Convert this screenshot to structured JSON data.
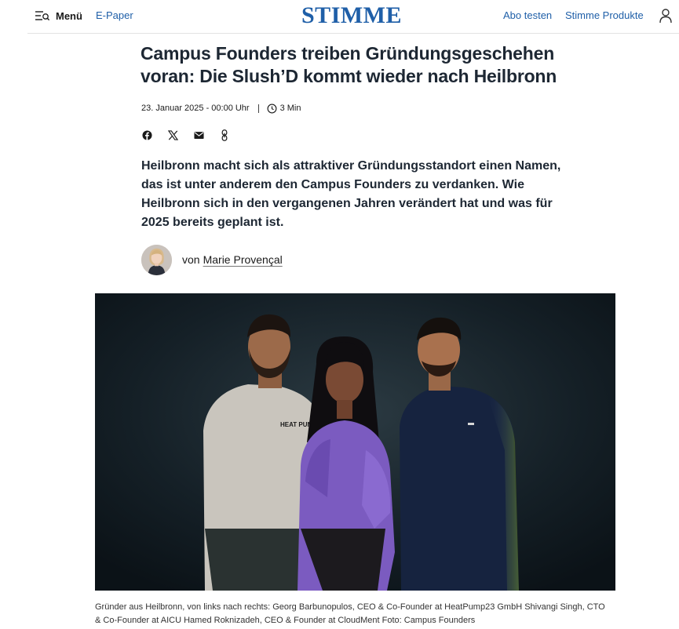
{
  "header": {
    "menu_label": "Menü",
    "epaper_label": "E-Paper",
    "logo_text": "STIMME",
    "abo_label": "Abo testen",
    "produkte_label": "Stimme Produkte",
    "brand_color": "#1f5fa8"
  },
  "article": {
    "headline": "Campus Founders treiben Gründungsgeschehen voran: Die Slush’D kommt wieder nach Heilbronn",
    "date": "23. Januar 2025 - 00:00 Uhr",
    "read_time": "3 Min",
    "share": [
      "facebook-icon",
      "x-icon",
      "mail-icon",
      "link-icon"
    ],
    "lead": "Heilbronn macht sich als attraktiver Gründungsstandort einen Namen, das ist unter anderem den Campus Founders zu verdanken. Wie Heilbronn sich in den vergangenen Jahren verändert hat und was für 2025 bereits geplant ist.",
    "author_prefix": "von",
    "author_name": "Marie Provençal",
    "photo_caption": "Gründer aus Heilbronn, von links nach rechts: Georg Barbunopulos, CEO & Co-Founder at HeatPump23 GmbH Shivangi Singh, CTO & Co-Founder at AICU Hamed Roknizadeh, CEO & Founder at CloudMent  Foto: Campus Founders",
    "sweater_logo_text": "HEAT PUMP23"
  }
}
